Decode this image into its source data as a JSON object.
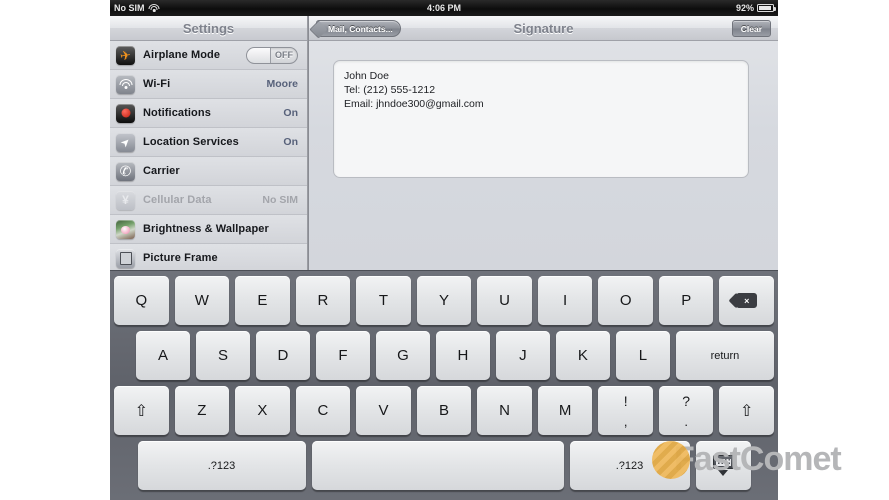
{
  "statusbar": {
    "carrier": "No SIM",
    "wifi_icon": "wifi-icon",
    "time": "4:06 PM",
    "battery_percent": "92%",
    "battery_icon": "battery-icon"
  },
  "sidebar": {
    "title": "Settings",
    "items": [
      {
        "label": "Airplane Mode",
        "icon": "airplane-icon",
        "value": "",
        "toggle": "OFF",
        "dim": false
      },
      {
        "label": "Wi-Fi",
        "icon": "wifi-icon",
        "value": "Moore",
        "dim": false
      },
      {
        "label": "Notifications",
        "icon": "notifications-icon",
        "value": "On",
        "dim": false
      },
      {
        "label": "Location Services",
        "icon": "location-icon",
        "value": "On",
        "dim": false
      },
      {
        "label": "Carrier",
        "icon": "phone-icon",
        "value": "",
        "dim": false
      },
      {
        "label": "Cellular Data",
        "icon": "cellular-icon",
        "value": "No SIM",
        "dim": true
      },
      {
        "label": "Brightness & Wallpaper",
        "icon": "wallpaper-icon",
        "value": "",
        "dim": false
      },
      {
        "label": "Picture Frame",
        "icon": "picture-frame-icon",
        "value": "",
        "dim": false
      }
    ]
  },
  "detail": {
    "back_label": "Mail, Contacts...",
    "title": "Signature",
    "clear_label": "Clear",
    "signature": {
      "line1": "John Doe",
      "line2": "Tel: (212) 555-1212",
      "line3": "Email: jhndoe300@gmail.com"
    }
  },
  "keyboard": {
    "row1": [
      "Q",
      "W",
      "E",
      "R",
      "T",
      "Y",
      "U",
      "I",
      "O",
      "P"
    ],
    "backspace": "⌫",
    "row2": [
      "A",
      "S",
      "D",
      "F",
      "G",
      "H",
      "J",
      "K",
      "L"
    ],
    "return_label": "return",
    "row3": [
      "Z",
      "X",
      "C",
      "V",
      "B",
      "N",
      "M"
    ],
    "shift_glyph": "⇧",
    "punct1": {
      "top": "!",
      "bottom": ","
    },
    "punct2": {
      "top": "?",
      "bottom": "."
    },
    "num_label": ".?123",
    "num_label_right": ".?123",
    "space_label": "",
    "hide_label": "hide-keyboard"
  },
  "watermark": {
    "text": "FastComet",
    "logo_color": "#e8ab45",
    "text_color": "#b5b6b8"
  }
}
